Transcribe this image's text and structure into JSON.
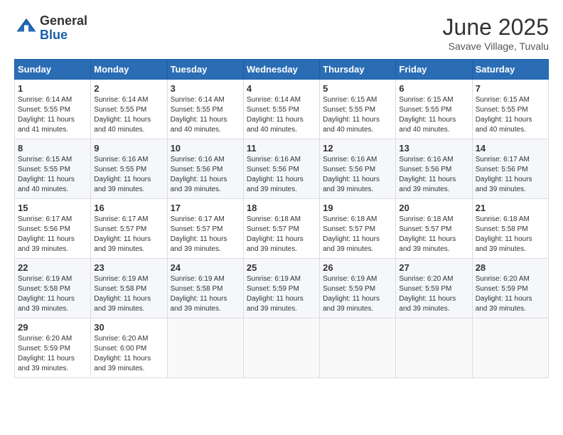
{
  "header": {
    "logo_line1": "General",
    "logo_line2": "Blue",
    "month": "June 2025",
    "location": "Savave Village, Tuvalu"
  },
  "weekdays": [
    "Sunday",
    "Monday",
    "Tuesday",
    "Wednesday",
    "Thursday",
    "Friday",
    "Saturday"
  ],
  "weeks": [
    [
      {
        "day": "1",
        "sunrise": "6:14 AM",
        "sunset": "5:55 PM",
        "daylight": "11 hours and 41 minutes."
      },
      {
        "day": "2",
        "sunrise": "6:14 AM",
        "sunset": "5:55 PM",
        "daylight": "11 hours and 40 minutes."
      },
      {
        "day": "3",
        "sunrise": "6:14 AM",
        "sunset": "5:55 PM",
        "daylight": "11 hours and 40 minutes."
      },
      {
        "day": "4",
        "sunrise": "6:14 AM",
        "sunset": "5:55 PM",
        "daylight": "11 hours and 40 minutes."
      },
      {
        "day": "5",
        "sunrise": "6:15 AM",
        "sunset": "5:55 PM",
        "daylight": "11 hours and 40 minutes."
      },
      {
        "day": "6",
        "sunrise": "6:15 AM",
        "sunset": "5:55 PM",
        "daylight": "11 hours and 40 minutes."
      },
      {
        "day": "7",
        "sunrise": "6:15 AM",
        "sunset": "5:55 PM",
        "daylight": "11 hours and 40 minutes."
      }
    ],
    [
      {
        "day": "8",
        "sunrise": "6:15 AM",
        "sunset": "5:55 PM",
        "daylight": "11 hours and 40 minutes."
      },
      {
        "day": "9",
        "sunrise": "6:16 AM",
        "sunset": "5:55 PM",
        "daylight": "11 hours and 39 minutes."
      },
      {
        "day": "10",
        "sunrise": "6:16 AM",
        "sunset": "5:56 PM",
        "daylight": "11 hours and 39 minutes."
      },
      {
        "day": "11",
        "sunrise": "6:16 AM",
        "sunset": "5:56 PM",
        "daylight": "11 hours and 39 minutes."
      },
      {
        "day": "12",
        "sunrise": "6:16 AM",
        "sunset": "5:56 PM",
        "daylight": "11 hours and 39 minutes."
      },
      {
        "day": "13",
        "sunrise": "6:16 AM",
        "sunset": "5:56 PM",
        "daylight": "11 hours and 39 minutes."
      },
      {
        "day": "14",
        "sunrise": "6:17 AM",
        "sunset": "5:56 PM",
        "daylight": "11 hours and 39 minutes."
      }
    ],
    [
      {
        "day": "15",
        "sunrise": "6:17 AM",
        "sunset": "5:56 PM",
        "daylight": "11 hours and 39 minutes."
      },
      {
        "day": "16",
        "sunrise": "6:17 AM",
        "sunset": "5:57 PM",
        "daylight": "11 hours and 39 minutes."
      },
      {
        "day": "17",
        "sunrise": "6:17 AM",
        "sunset": "5:57 PM",
        "daylight": "11 hours and 39 minutes."
      },
      {
        "day": "18",
        "sunrise": "6:18 AM",
        "sunset": "5:57 PM",
        "daylight": "11 hours and 39 minutes."
      },
      {
        "day": "19",
        "sunrise": "6:18 AM",
        "sunset": "5:57 PM",
        "daylight": "11 hours and 39 minutes."
      },
      {
        "day": "20",
        "sunrise": "6:18 AM",
        "sunset": "5:57 PM",
        "daylight": "11 hours and 39 minutes."
      },
      {
        "day": "21",
        "sunrise": "6:18 AM",
        "sunset": "5:58 PM",
        "daylight": "11 hours and 39 minutes."
      }
    ],
    [
      {
        "day": "22",
        "sunrise": "6:19 AM",
        "sunset": "5:58 PM",
        "daylight": "11 hours and 39 minutes."
      },
      {
        "day": "23",
        "sunrise": "6:19 AM",
        "sunset": "5:58 PM",
        "daylight": "11 hours and 39 minutes."
      },
      {
        "day": "24",
        "sunrise": "6:19 AM",
        "sunset": "5:58 PM",
        "daylight": "11 hours and 39 minutes."
      },
      {
        "day": "25",
        "sunrise": "6:19 AM",
        "sunset": "5:59 PM",
        "daylight": "11 hours and 39 minutes."
      },
      {
        "day": "26",
        "sunrise": "6:19 AM",
        "sunset": "5:59 PM",
        "daylight": "11 hours and 39 minutes."
      },
      {
        "day": "27",
        "sunrise": "6:20 AM",
        "sunset": "5:59 PM",
        "daylight": "11 hours and 39 minutes."
      },
      {
        "day": "28",
        "sunrise": "6:20 AM",
        "sunset": "5:59 PM",
        "daylight": "11 hours and 39 minutes."
      }
    ],
    [
      {
        "day": "29",
        "sunrise": "6:20 AM",
        "sunset": "5:59 PM",
        "daylight": "11 hours and 39 minutes."
      },
      {
        "day": "30",
        "sunrise": "6:20 AM",
        "sunset": "6:00 PM",
        "daylight": "11 hours and 39 minutes."
      },
      null,
      null,
      null,
      null,
      null
    ]
  ],
  "labels": {
    "sunrise": "Sunrise:",
    "sunset": "Sunset:",
    "daylight": "Daylight:"
  }
}
